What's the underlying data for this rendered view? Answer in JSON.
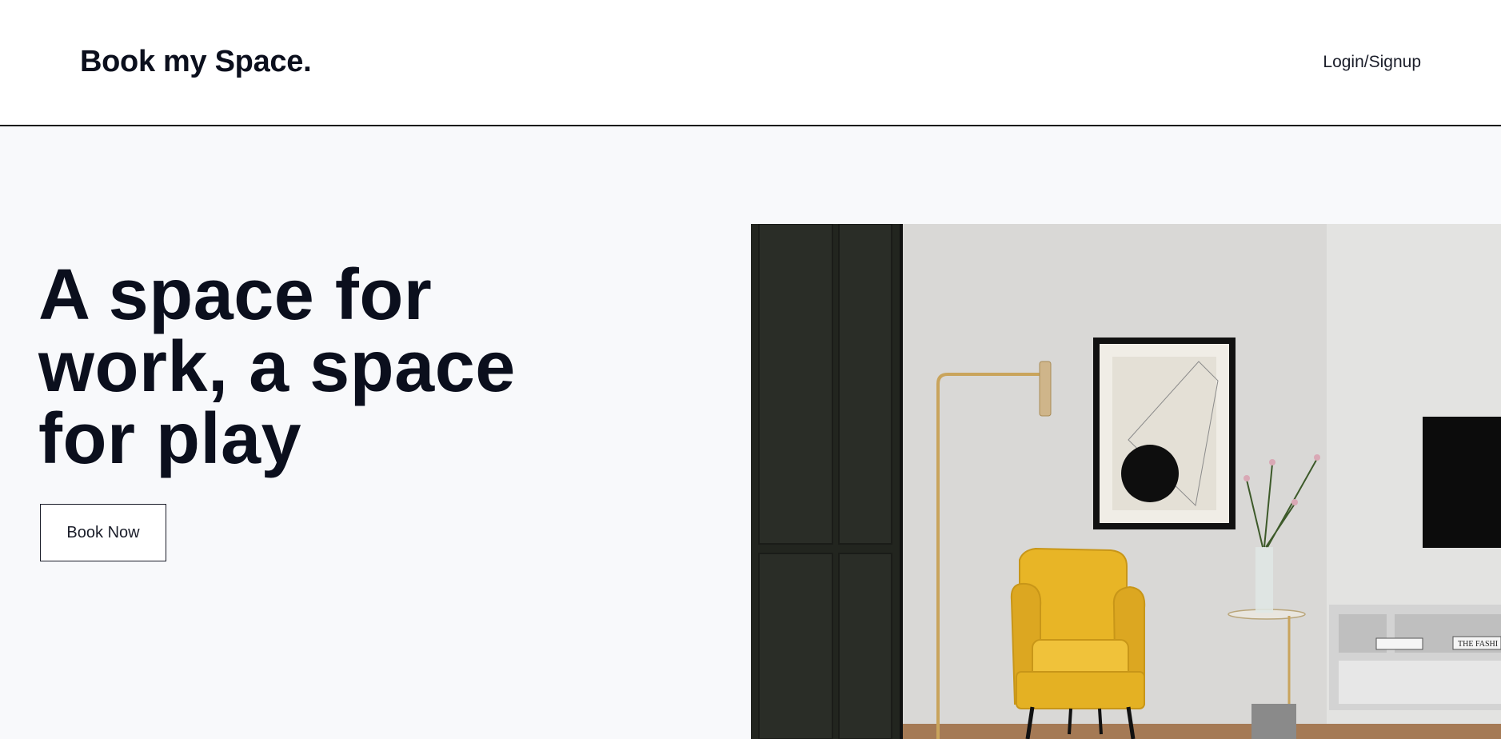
{
  "header": {
    "brand": "Book my Space.",
    "login_label": "Login/Signup"
  },
  "hero": {
    "headline": "A space for work, a space for play",
    "cta_label": "Book Now",
    "image": {
      "subject": "living room with yellow armchair, brass floor lamp, framed abstract print and TV console",
      "book_text": "THE FASHI"
    }
  },
  "colors": {
    "text": "#0b0f1d",
    "page_background": "#f8f9fb",
    "header_background": "#ffffff",
    "armchair": "#e8b526"
  }
}
